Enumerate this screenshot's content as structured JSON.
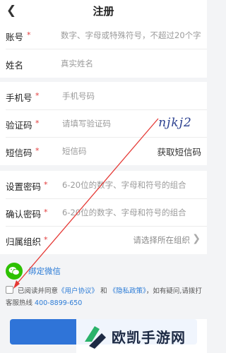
{
  "header": {
    "back_icon": "back-chevron-icon",
    "title": "注册"
  },
  "account": {
    "label": "账号",
    "required_mark": "*",
    "placeholder": "数字、字母或特殊符号，不超过20个字"
  },
  "name": {
    "label": "姓名",
    "placeholder": "真实姓名"
  },
  "phone": {
    "label": "手机号",
    "required_mark": "*",
    "placeholder": "手机号码"
  },
  "captcha": {
    "label": "验证码",
    "required_mark": "*",
    "placeholder": "请填写验证码",
    "image_text": "njkj2"
  },
  "sms": {
    "label": "短信码",
    "required_mark": "*",
    "placeholder": "短信码",
    "button": "获取短信码"
  },
  "password": {
    "label": "设置密码",
    "required_mark": "*",
    "placeholder": "6-20位的数字、字母和符号的组合"
  },
  "confirm_password": {
    "label": "确认密码",
    "required_mark": "*",
    "placeholder": "6-20位的数字、字母和符号的组合"
  },
  "organization": {
    "label": "归属组织",
    "required_mark": "*",
    "value": "请选择所在组织",
    "chevron_icon": "chevron-right-icon"
  },
  "wechat": {
    "icon": "wechat-icon",
    "label": "绑定微信"
  },
  "agreement": {
    "prefix": "已阅读并同意",
    "user_agreement": "《用户协议》",
    "and": "和",
    "privacy_policy": "《隐私政策》",
    "suffix": "，如有疑问,请拨打客服热线",
    "hotline": "400-8899-650"
  },
  "watermark": {
    "text": "欧凯手游网"
  },
  "colors": {
    "accent": "#2f74d8",
    "required": "#e23b3b",
    "link": "#2b7bd6",
    "wechat": "#2dc100",
    "annotation_arrow": "#e53935"
  }
}
